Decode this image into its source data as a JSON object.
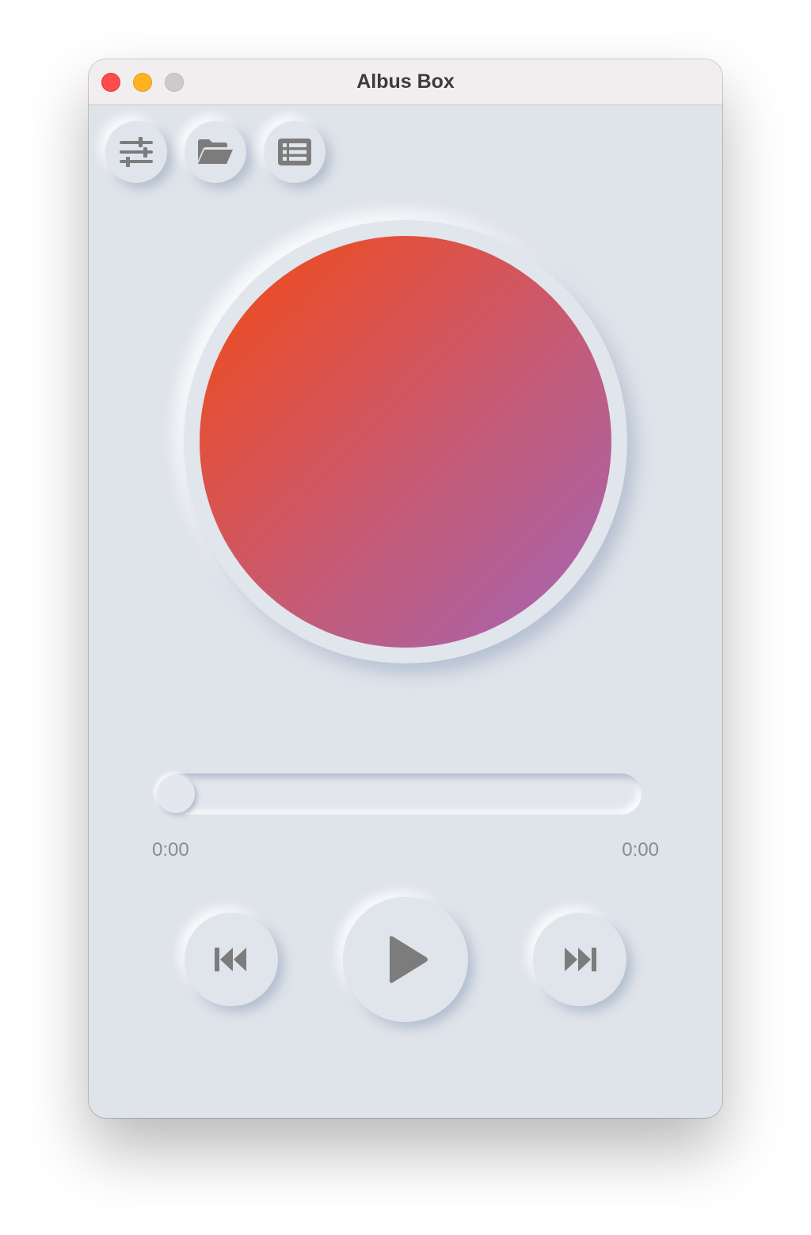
{
  "window": {
    "title": "Albus Box"
  },
  "toolbar": {
    "buttons": [
      {
        "name": "equalizer",
        "icon": "sliders-icon"
      },
      {
        "name": "open-folder",
        "icon": "folder-open-icon"
      },
      {
        "name": "playlist",
        "icon": "list-icon"
      }
    ]
  },
  "album_art": {
    "gradient_colors": [
      "#f24a12",
      "#a365b8"
    ]
  },
  "progress": {
    "value": 0,
    "elapsed": "0:00",
    "duration": "0:00"
  },
  "controls": {
    "previous_icon": "skip-back-icon",
    "play_icon": "play-icon",
    "next_icon": "skip-forward-icon"
  },
  "colors": {
    "background": "#e0e4eb",
    "icon": "#7c7c7c",
    "close": "#fe4b4b",
    "minimize": "#ffb321",
    "zoom": "#cecaca"
  }
}
